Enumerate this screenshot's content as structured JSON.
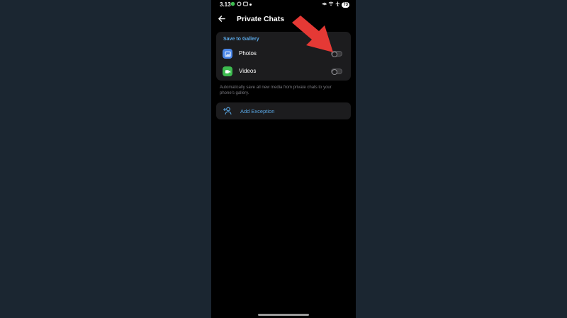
{
  "status_bar": {
    "time": "3.13",
    "battery": "73",
    "left_icons": [
      "sync-icon",
      "location-icon",
      "gallery-icon",
      "dot"
    ],
    "right_icons": [
      "mute-icon",
      "wifi-icon",
      "airplane-icon"
    ]
  },
  "header": {
    "title": "Private Chats",
    "back_icon": "arrow-left-icon"
  },
  "save_to_gallery": {
    "section_title": "Save to Gallery",
    "items": [
      {
        "label": "Photos",
        "icon": "photo-icon",
        "icon_color": "#4a86e8",
        "enabled": false
      },
      {
        "label": "Videos",
        "icon": "video-icon",
        "icon_color": "#3dbb4f",
        "enabled": false
      }
    ],
    "hint": "Automatically save all new media from private chats to your phone's gallery."
  },
  "exception": {
    "label": "Add Exception",
    "icon": "add-user-icon"
  },
  "colors": {
    "accent": "#5aa8e6",
    "background": "#000000",
    "card": "#1c1c1e",
    "annotation_arrow": "#e53935"
  }
}
